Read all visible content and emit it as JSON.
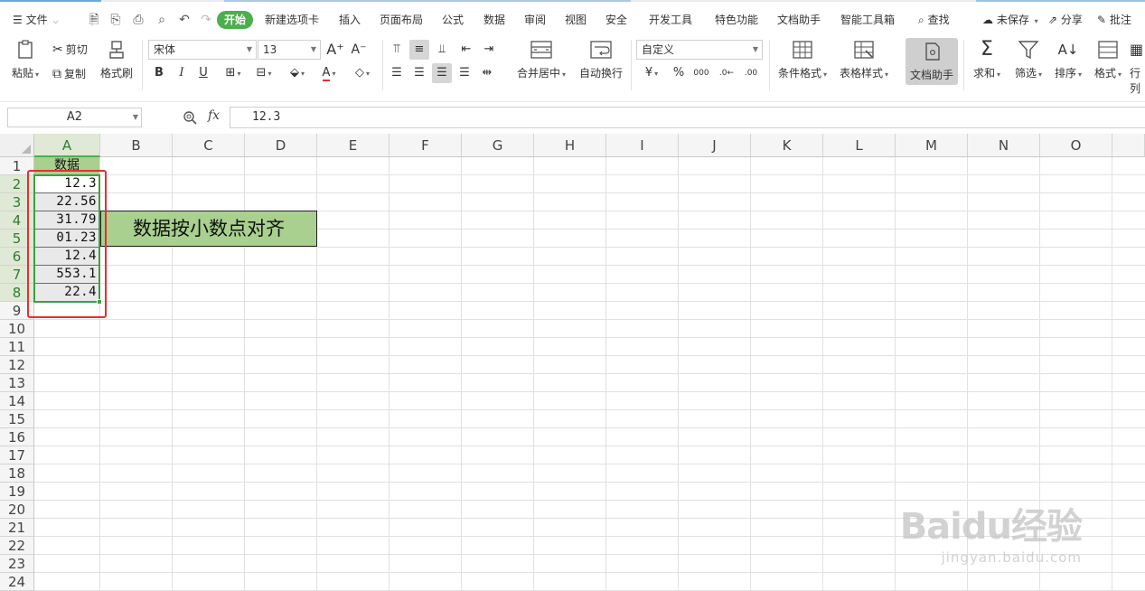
{
  "menubar": {
    "file_label": "文件",
    "tabs": [
      "开始",
      "新建选项卡",
      "插入",
      "页面布局",
      "公式",
      "数据",
      "审阅",
      "视图",
      "安全",
      "开发工具",
      "特色功能",
      "文档助手",
      "智能工具箱"
    ],
    "active_tab": "开始",
    "search_label": "查找",
    "unsaved_label": "未保存",
    "share_label": "分享",
    "comment_label": "批注"
  },
  "ribbon": {
    "paste": "粘贴",
    "cut": "剪切",
    "copy": "复制",
    "format_painter": "格式刷",
    "font_name": "宋体",
    "font_size": "13",
    "bold": "B",
    "italic": "I",
    "underline": "U",
    "merge_center": "合并居中",
    "wrap_text": "自动换行",
    "number_format": "自定义",
    "conditional_format": "条件格式",
    "table_style": "表格样式",
    "doc_assistant": "文档助手",
    "sum": "求和",
    "filter": "筛选",
    "sort": "排序",
    "format": "格式",
    "rowcol": "行列"
  },
  "formula_bar": {
    "name_box": "A2",
    "fx": "fx",
    "value": "12.3"
  },
  "sheet": {
    "columns": [
      "A",
      "B",
      "C",
      "D",
      "E",
      "F",
      "G",
      "H",
      "I",
      "J",
      "K",
      "L",
      "M",
      "N",
      "O"
    ],
    "rows": [
      "1",
      "2",
      "3",
      "4",
      "5",
      "6",
      "7",
      "8",
      "9",
      "10",
      "11",
      "12",
      "13",
      "14",
      "15",
      "16",
      "17",
      "18",
      "19",
      "20",
      "21",
      "22",
      "23",
      "24"
    ],
    "header": "数据",
    "values": [
      "12.3",
      "22.56",
      "31.79",
      "01.23",
      "12.4",
      "553.1",
      "22.4"
    ],
    "note": "数据按小数点对齐"
  },
  "watermark": {
    "brand": "Baidu经验",
    "url": "jingyan.baidu.com"
  },
  "colors": {
    "accent_green": "#4cae4c",
    "cell_green": "#a9d08e",
    "highlight_red": "#e53030"
  }
}
